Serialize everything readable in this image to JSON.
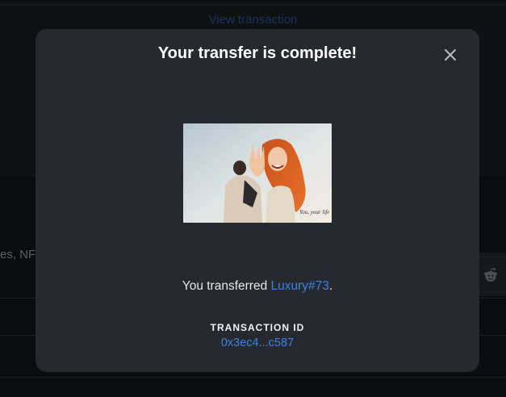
{
  "background": {
    "top_link": "View transaction",
    "partial_text": "es, NFT",
    "share_icon": "reddit-icon"
  },
  "modal": {
    "title": "Your transfer is complete!",
    "close_icon": "close-icon",
    "image_alt": "Luxury#73 NFT image",
    "image_caption": "You, your life",
    "transfer_prefix": "You transferred ",
    "item_name": "Luxury#73",
    "transfer_suffix": ".",
    "transaction_label": "TRANSACTION ID",
    "transaction_id": "0x3ec4...c587"
  },
  "colors": {
    "modal_bg": "#262a2e",
    "link": "#3b82e8",
    "backdrop": "#0c0d0e"
  }
}
